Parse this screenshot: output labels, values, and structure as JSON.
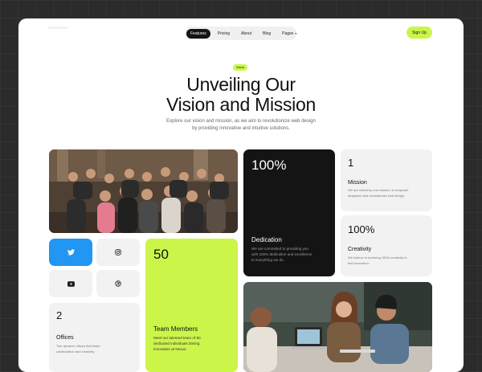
{
  "nav": {
    "items": [
      {
        "label": "Features",
        "active": true
      },
      {
        "label": "Pricing",
        "active": false
      },
      {
        "label": "About",
        "active": false
      },
      {
        "label": "Blog",
        "active": false
      },
      {
        "label": "Pages",
        "active": false
      }
    ],
    "pages_caret": "▾",
    "signup_label": "Sign Up"
  },
  "hero": {
    "badge": "About",
    "title_lines": [
      "Unveiling Our",
      "Vision and Mission"
    ],
    "subtitle_lines": [
      "Explore our vision and mission, as we aim to revolutionize web design",
      "by providing innovative and intuitive solutions."
    ]
  },
  "cards": {
    "dedication": {
      "value": "100%",
      "title": "Dedication",
      "desc_lines": [
        "We are committed to providing you",
        "with 100% dedication and excellence",
        "in everything we do."
      ]
    },
    "mission": {
      "value": "1",
      "title": "Mission",
      "desc_lines": [
        "We are united by one mission: to empower",
        "designers and revolutionize web design."
      ]
    },
    "creativity": {
      "value": "100%",
      "title": "Creativity",
      "desc_lines": [
        "We believe in nurturing 100% creativity to",
        "fuel innovation."
      ]
    },
    "team": {
      "value": "50",
      "title": "Team Members",
      "desc_lines": [
        "Meet our talented team of 50",
        "dedicated individuals driving",
        "innovation at Nexus."
      ]
    },
    "offices": {
      "value": "2",
      "title": "Offices",
      "desc_lines": [
        "Two dynamic offices that foster",
        "collaboration and creativity."
      ]
    }
  },
  "social": [
    {
      "icon": "twitter-icon",
      "color": "#2196f3"
    },
    {
      "icon": "instagram-icon"
    },
    {
      "icon": "youtube-icon"
    },
    {
      "icon": "dribbble-icon"
    }
  ],
  "colors": {
    "accent": "#ccf54a",
    "dark_card": "#141414",
    "twitter_blue": "#2196f3",
    "light_card": "#f2f2f2"
  }
}
